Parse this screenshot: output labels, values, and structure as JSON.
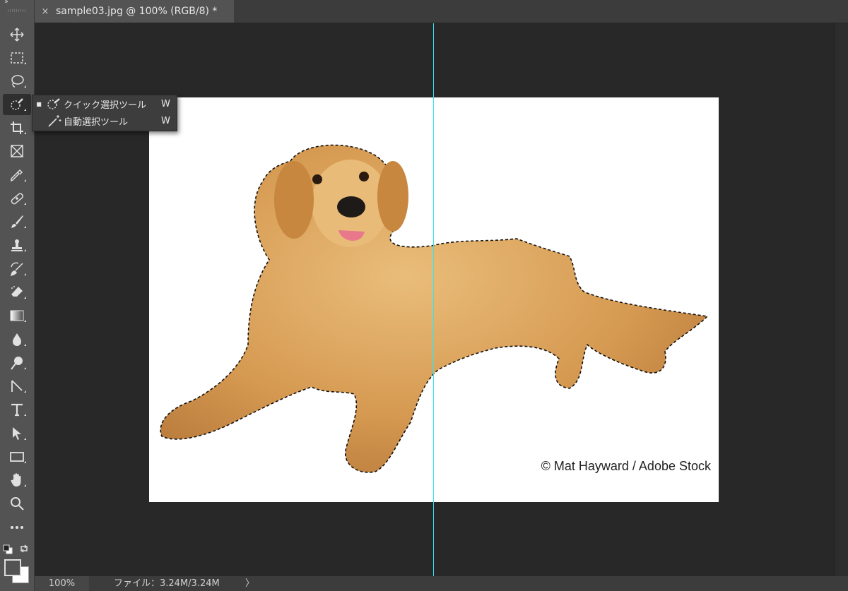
{
  "tab": {
    "title": "sample03.jpg @ 100% (RGB/8) *",
    "close": "×"
  },
  "toolbar": {
    "collapse": "››",
    "tools": [
      {
        "name": "move-tool",
        "icon": "move-icon"
      },
      {
        "name": "marquee-tool",
        "icon": "rect-marquee-icon"
      },
      {
        "name": "lasso-tool",
        "icon": "lasso-icon"
      },
      {
        "name": "quick-selection-tool",
        "icon": "quick-selection-icon",
        "active": true
      },
      {
        "name": "crop-tool",
        "icon": "crop-icon"
      },
      {
        "name": "frame-tool",
        "icon": "frame-icon"
      },
      {
        "name": "eyedropper-tool",
        "icon": "eyedropper-icon"
      },
      {
        "name": "healing-brush-tool",
        "icon": "bandage-icon"
      },
      {
        "name": "brush-tool",
        "icon": "brush-icon"
      },
      {
        "name": "clone-stamp-tool",
        "icon": "stamp-icon"
      },
      {
        "name": "history-brush-tool",
        "icon": "history-brush-icon"
      },
      {
        "name": "eraser-tool",
        "icon": "eraser-icon"
      },
      {
        "name": "gradient-tool",
        "icon": "gradient-icon"
      },
      {
        "name": "blur-tool",
        "icon": "drop-icon"
      },
      {
        "name": "dodge-tool",
        "icon": "dodge-icon"
      },
      {
        "name": "pen-tool",
        "icon": "pen-icon"
      },
      {
        "name": "type-tool",
        "icon": "type-icon"
      },
      {
        "name": "path-selection-tool",
        "icon": "arrow-icon"
      },
      {
        "name": "rectangle-tool",
        "icon": "rectangle-icon"
      },
      {
        "name": "hand-tool",
        "icon": "hand-icon"
      },
      {
        "name": "zoom-tool",
        "icon": "magnifier-icon"
      },
      {
        "name": "more-tools",
        "icon": "ellipsis-icon"
      }
    ],
    "foreground_color": "#535353",
    "background_color": "#ffffff"
  },
  "flyout": {
    "items": [
      {
        "label": "クイック選択ツール",
        "key": "W",
        "selected": true,
        "mark": "■",
        "icon": "quick-selection-icon"
      },
      {
        "label": "自動選択ツール",
        "key": "W",
        "selected": false,
        "mark": "",
        "icon": "magic-wand-icon"
      }
    ]
  },
  "canvas": {
    "credit": "© Mat Hayward / Adobe Stock",
    "guide_color": "#37e4f0",
    "background": "#ffffff"
  },
  "status": {
    "zoom": "100%",
    "file_info": "ファイル：3.24M/3.24M",
    "arrow": "〉"
  }
}
